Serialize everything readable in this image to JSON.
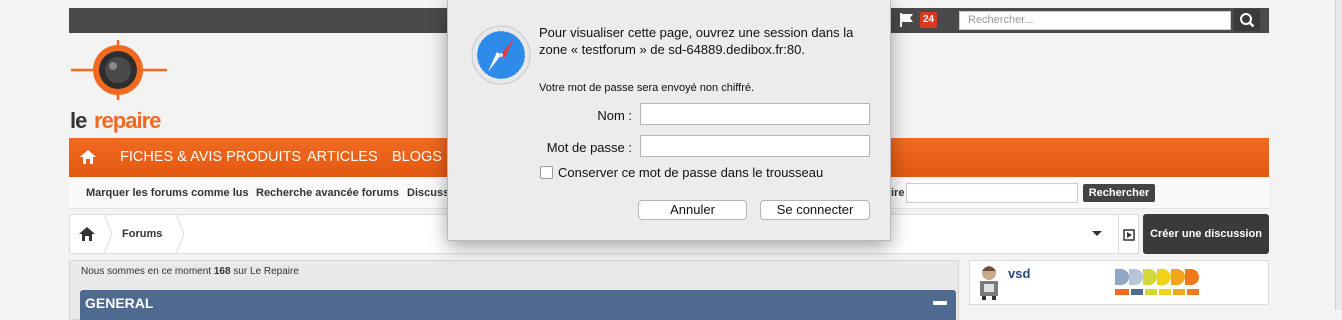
{
  "topbar": {
    "notification_count": "24",
    "search_placeholder": "Rechercher..."
  },
  "logo": {
    "text_le": "le",
    "text_repaire": "repaire"
  },
  "nav": {
    "items": [
      "FICHES & AVIS PRODUITS",
      "ARTICLES",
      "BLOGS"
    ]
  },
  "subnav": {
    "items": [
      "Marquer les forums comme lus",
      "Recherche avancée forums",
      "Discussi"
    ],
    "right_fragment": "ire",
    "search_button": "Rechercher"
  },
  "breadcrumb": {
    "forums": "Forums",
    "create_button": "Créer une discussion"
  },
  "content": {
    "online_prefix": "Nous sommes en ce moment ",
    "online_count": "168",
    "online_suffix": " sur Le Repaire",
    "section_title": "GENERAL"
  },
  "user": {
    "name": "vsd"
  },
  "dialog": {
    "message": "Pour visualiser cette page, ouvrez une session dans la zone « testforum » de sd-64889.dedibox.fr:80.",
    "note": "Votre mot de passe sera envoyé non chiffré.",
    "name_label": "Nom :",
    "password_label": "Mot de passe :",
    "keep_label": "Conserver ce mot de passe dans le trousseau",
    "cancel": "Annuler",
    "connect": "Se connecter"
  },
  "colors": {
    "accent_orange": "#f26a21",
    "dark_bar": "#4a4a4a",
    "section_blue": "#4f6a91",
    "badge_red": "#d9391f"
  }
}
